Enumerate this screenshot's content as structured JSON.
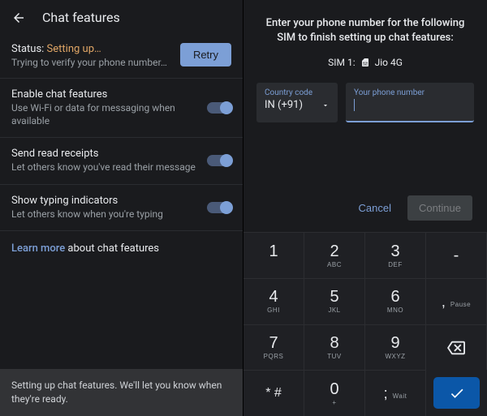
{
  "left": {
    "title": "Chat features",
    "status_label": "Status: ",
    "status_value": "Setting up…",
    "status_sub": "Trying to verify your phone number…",
    "retry": "Retry",
    "settings": [
      {
        "title": "Enable chat features",
        "sub": "Use Wi-Fi or data for messaging when available"
      },
      {
        "title": "Send read receipts",
        "sub": "Let others know you've read their message"
      },
      {
        "title": "Show typing indicators",
        "sub": "Let others know when you're typing"
      }
    ],
    "learn_link": "Learn more",
    "learn_rest": " about chat features",
    "snackbar": "Setting up chat features. We'll let you know when they're ready."
  },
  "right": {
    "prompt": "Enter your phone number for the following SIM to finish setting up chat features:",
    "sim_label": "SIM 1:",
    "sim_carrier": "Jio 4G",
    "country_label": "Country code",
    "country_value": "IN (+91)",
    "phone_label": "Your phone number",
    "cancel": "Cancel",
    "continue": "Continue",
    "keys": {
      "k1": "1",
      "k2": "2",
      "k2l": "ABC",
      "k3": "3",
      "k3l": "DEF",
      "k4": "4",
      "k4l": "GHI",
      "k5": "5",
      "k5l": "JKL",
      "k6": "6",
      "k6l": "MNO",
      "k7": "7",
      "k7l": "PQRS",
      "k8": "8",
      "k8l": "TUV",
      "k9": "9",
      "k9l": "WXYZ",
      "kstar": "* #",
      "k0": "0",
      "k0l": "+",
      "kdash": "- .",
      "pause": "Pause",
      "wait": "Wait",
      "minus": "-"
    }
  }
}
